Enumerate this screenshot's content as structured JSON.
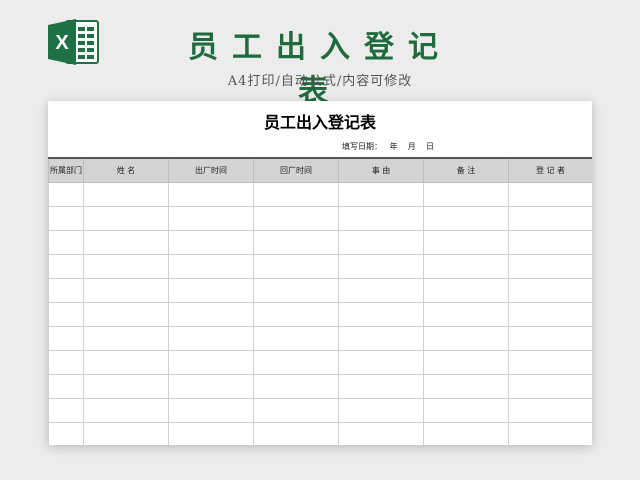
{
  "header": {
    "title": "员工出入登记表",
    "subtitle": "A4打印/自动公式/内容可修改"
  },
  "sheet": {
    "title": "员工出入登记表",
    "fill_date": "填写日期：   年    月    日",
    "columns": [
      "所属部门",
      "姓  名",
      "出厂时间",
      "回厂时间",
      "事    由",
      "备  注",
      "登 记 者"
    ],
    "row_count": 11
  },
  "colors": {
    "brand_green": "#1f6b3d",
    "excel_green": "#1e7145",
    "header_fill": "#d4d4d4"
  },
  "icons": {
    "logo": "excel-icon"
  }
}
